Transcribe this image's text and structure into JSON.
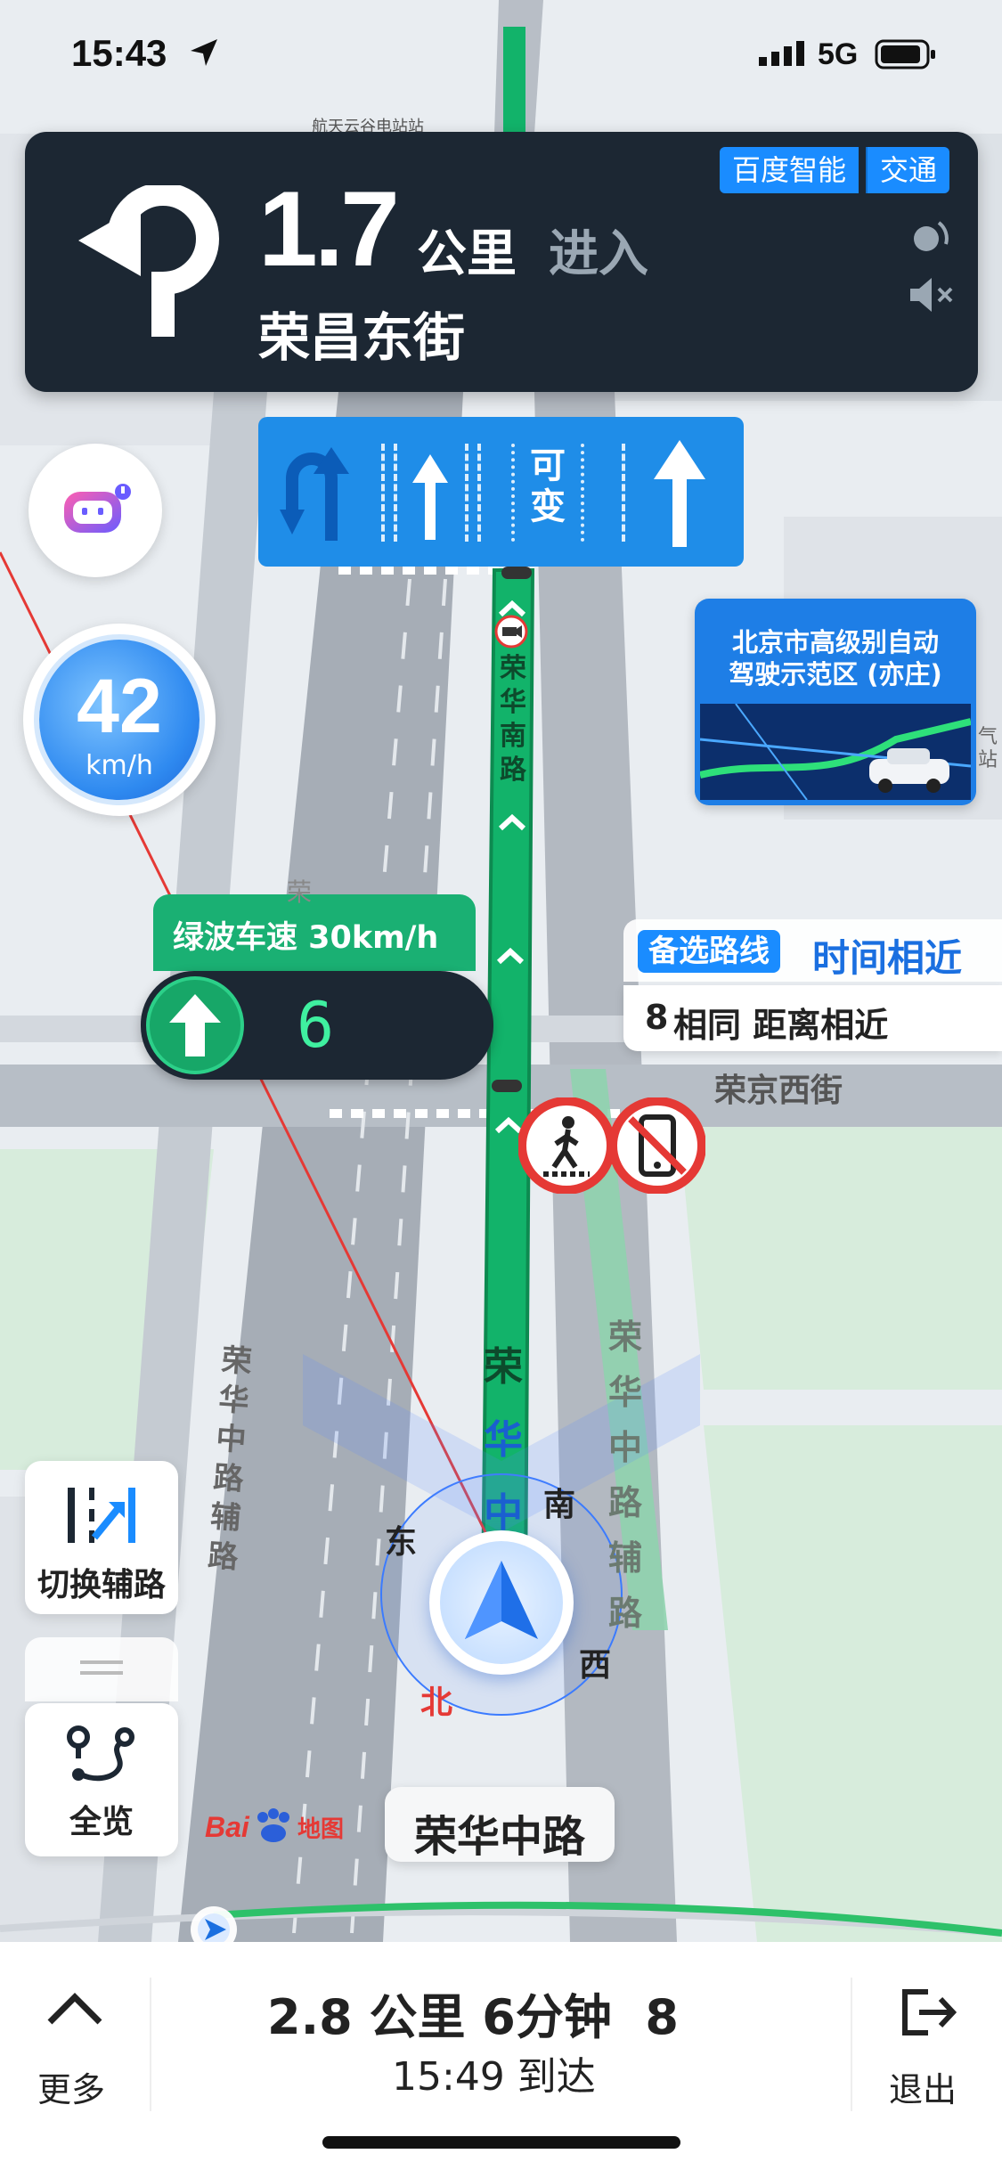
{
  "status_bar": {
    "time": "15:43",
    "network": "5G"
  },
  "banner": {
    "distance": "1.7",
    "distance_unit": "公里",
    "action": "进入",
    "street": "荣昌东街",
    "tag_left": "百度智能",
    "tag_right": "交通"
  },
  "lanes": {
    "variable_lane_text": [
      "可",
      "变"
    ]
  },
  "speed": {
    "value": "42",
    "unit": "km/h"
  },
  "green_wave": {
    "title": "绿波车速 30km/h",
    "countdown": "6"
  },
  "autodrive_card": {
    "line1": "北京市高级别自动",
    "line2": "驾驶示范区 (亦庄)"
  },
  "alt_route": {
    "tag": "备选路线",
    "time_label": "时间相近",
    "detail_count": "8",
    "detail_text": "相同 距离相近"
  },
  "map_labels": {
    "rongjing_west": "荣京西街",
    "main_road_vertical": [
      "荣",
      "华",
      "南",
      "路"
    ],
    "main_road_bottom": [
      "荣",
      "华",
      "中"
    ],
    "left_aux": [
      "荣",
      "华",
      "中",
      "路",
      "辅",
      "路"
    ],
    "right_aux": [
      "荣",
      "华",
      "中",
      "路",
      "辅",
      "路"
    ],
    "top_poi": "航天云谷电站站",
    "side_cut": "气站",
    "left_cut": "荣"
  },
  "compass": {
    "east": "东",
    "south": "南",
    "west": "西",
    "north": "北"
  },
  "buttons": {
    "switch_aux": "切换辅路",
    "overview": "全览",
    "more": "更多",
    "exit": "退出"
  },
  "current_road": "荣华中路",
  "logo": {
    "text": "Bai",
    "suffix": "地图"
  },
  "trip": {
    "summary": "2.8 公里 6分钟  8",
    "arrival": "15:49 到达"
  },
  "colors": {
    "route_green": "#12b36a",
    "banner_bg": "#1c2733",
    "accent_blue": "#1a8cff",
    "warning_red": "#e53935"
  }
}
